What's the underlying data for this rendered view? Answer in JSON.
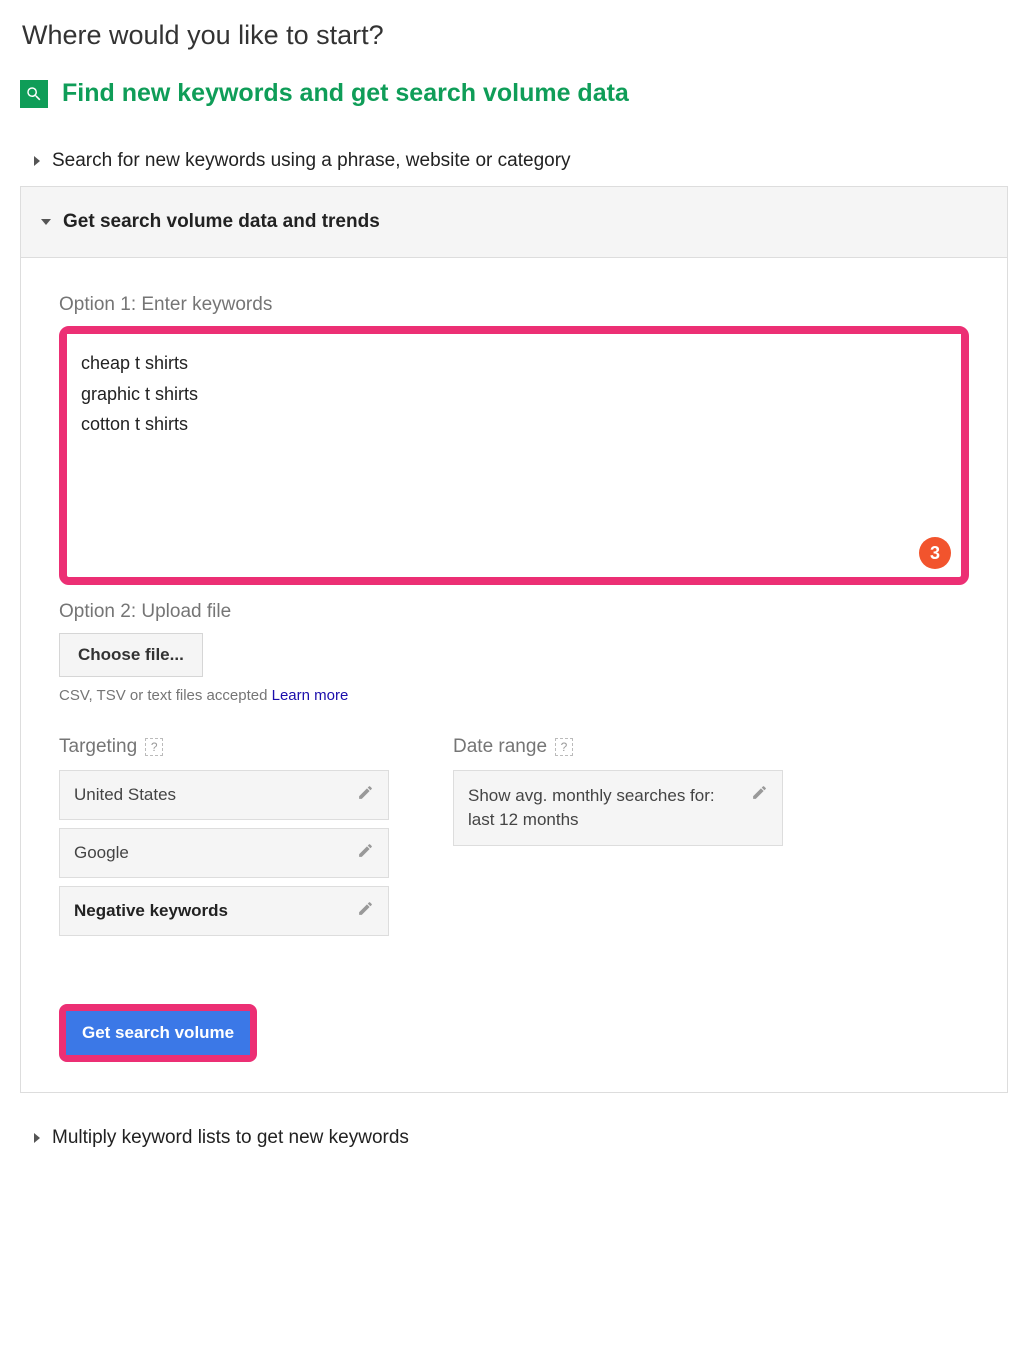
{
  "page": {
    "title": "Where would you like to start?"
  },
  "section": {
    "title": "Find new keywords and get search volume data"
  },
  "accordion": {
    "search_phrase": "Search for new keywords using a phrase, website or category",
    "get_volume_trends": "Get search volume data and trends",
    "multiply_lists": "Multiply keyword lists to get new keywords"
  },
  "option1": {
    "label": "Option 1: Enter keywords",
    "keywords_text": "cheap t shirts\ngraphic t shirts\ncotton t shirts",
    "badge": "3"
  },
  "option2": {
    "label": "Option 2: Upload file",
    "button": "Choose file...",
    "accepted_prefix": "CSV, TSV or text files accepted ",
    "learn_more": "Learn more"
  },
  "targeting": {
    "label": "Targeting",
    "items": [
      "United States",
      "Google",
      "Negative keywords"
    ]
  },
  "date_range": {
    "label": "Date range",
    "text": "Show avg. monthly searches for: last 12 months"
  },
  "actions": {
    "get_search_volume": "Get search volume"
  }
}
